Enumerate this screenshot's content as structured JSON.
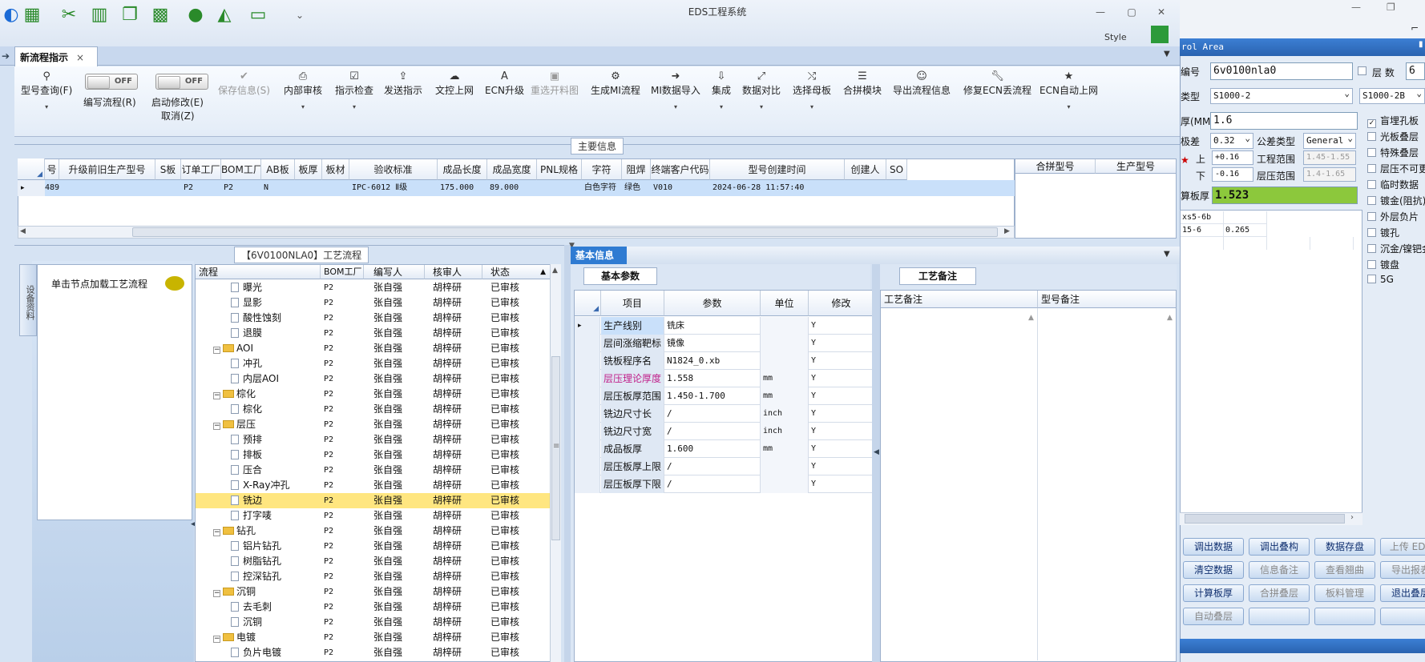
{
  "app": {
    "title": "EDS工程系统",
    "style_label": "Style"
  },
  "tabs": {
    "active": "新流程指示"
  },
  "toolbar": {
    "buttons": [
      {
        "label": "型号查询(F)",
        "icon": "search-icon"
      },
      {
        "label": "编写流程(R)",
        "icon": "toggle"
      },
      {
        "label": "启动修改(E)",
        "icon": "toggle"
      },
      {
        "label": "取消(Z)",
        "icon": ""
      },
      {
        "label": "保存信息(S)",
        "icon": "check-icon"
      },
      {
        "label": "内部审核",
        "icon": "print-icon"
      },
      {
        "label": "指示检查",
        "icon": "checkbox-icon"
      },
      {
        "label": "发送指示",
        "icon": "upload-icon"
      },
      {
        "label": "文控上网",
        "icon": "cloud-icon"
      },
      {
        "label": "ECN升级",
        "icon": "text-icon"
      },
      {
        "label": "重选开料图",
        "icon": "image-icon"
      },
      {
        "label": "生成MI流程",
        "icon": "gears-icon"
      },
      {
        "label": "MI数据导入",
        "icon": "import-icon"
      },
      {
        "label": "集成",
        "icon": "download-icon"
      },
      {
        "label": "数据对比",
        "icon": "compare-icon"
      },
      {
        "label": "选择母板",
        "icon": "shuffle-icon"
      },
      {
        "label": "合拼模块",
        "icon": "list-icon"
      },
      {
        "label": "导出流程信息",
        "icon": "smile-icon"
      },
      {
        "label": "修复ECN丢流程",
        "icon": "wrench-icon"
      },
      {
        "label": "ECN自动上网",
        "icon": "star-icon"
      }
    ],
    "toggle_off": "OFF"
  },
  "main_info": {
    "title": "主要信息",
    "columns": [
      "号",
      "升级前旧生产型号",
      "S板",
      "订单工厂",
      "BOM工厂",
      "AB板",
      "板厚",
      "板材",
      "验收标准",
      "成品长度",
      "成品宽度",
      "PNL规格",
      "字符",
      "阻焊",
      "终端客户代码",
      "型号创建时间",
      "创建人",
      "SO"
    ],
    "row": [
      "489",
      "",
      "",
      "P2",
      "P2",
      "N",
      "",
      "",
      "IPC-6012 Ⅱ级",
      "175.000",
      "89.000",
      "",
      "白色字符",
      "绿色",
      "V010",
      "2024-06-28 11:57:40",
      "",
      ""
    ],
    "merge_columns": [
      "合拼型号",
      "生产型号"
    ]
  },
  "process": {
    "title": "【6V0100NLA0】工艺流程",
    "side_tab": "设备资料",
    "node_hint": "单击节点加载工艺流程",
    "columns": [
      "流程",
      "BOM工厂",
      "编写人",
      "核审人",
      "状态"
    ],
    "rows": [
      {
        "name": "曝光",
        "level": 2,
        "type": "doc",
        "factory": "P2",
        "writer": "张自强",
        "reviewer": "胡梓研",
        "status": "已审核"
      },
      {
        "name": "显影",
        "level": 2,
        "type": "doc",
        "factory": "P2",
        "writer": "张自强",
        "reviewer": "胡梓研",
        "status": "已审核"
      },
      {
        "name": "酸性蚀刻",
        "level": 2,
        "type": "doc",
        "factory": "P2",
        "writer": "张自强",
        "reviewer": "胡梓研",
        "status": "已审核"
      },
      {
        "name": "退膜",
        "level": 2,
        "type": "doc",
        "factory": "P2",
        "writer": "张自强",
        "reviewer": "胡梓研",
        "status": "已审核"
      },
      {
        "name": "AOI",
        "level": 1,
        "type": "folder",
        "factory": "P2",
        "writer": "张自强",
        "reviewer": "胡梓研",
        "status": "已审核"
      },
      {
        "name": "冲孔",
        "level": 2,
        "type": "doc",
        "factory": "P2",
        "writer": "张自强",
        "reviewer": "胡梓研",
        "status": "已审核"
      },
      {
        "name": "内层AOI",
        "level": 2,
        "type": "doc",
        "factory": "P2",
        "writer": "张自强",
        "reviewer": "胡梓研",
        "status": "已审核"
      },
      {
        "name": "棕化",
        "level": 1,
        "type": "folder",
        "factory": "P2",
        "writer": "张自强",
        "reviewer": "胡梓研",
        "status": "已审核"
      },
      {
        "name": "棕化",
        "level": 2,
        "type": "doc",
        "factory": "P2",
        "writer": "张自强",
        "reviewer": "胡梓研",
        "status": "已审核"
      },
      {
        "name": "层压",
        "level": 1,
        "type": "folder",
        "factory": "P2",
        "writer": "张自强",
        "reviewer": "胡梓研",
        "status": "已审核"
      },
      {
        "name": "预排",
        "level": 2,
        "type": "doc",
        "factory": "P2",
        "writer": "张自强",
        "reviewer": "胡梓研",
        "status": "已审核"
      },
      {
        "name": "排板",
        "level": 2,
        "type": "doc",
        "factory": "P2",
        "writer": "张自强",
        "reviewer": "胡梓研",
        "status": "已审核"
      },
      {
        "name": "压合",
        "level": 2,
        "type": "doc",
        "factory": "P2",
        "writer": "张自强",
        "reviewer": "胡梓研",
        "status": "已审核"
      },
      {
        "name": "X-Ray冲孔",
        "level": 2,
        "type": "doc",
        "factory": "P2",
        "writer": "张自强",
        "reviewer": "胡梓研",
        "status": "已审核"
      },
      {
        "name": "铣边",
        "level": 2,
        "type": "doc",
        "factory": "P2",
        "writer": "张自强",
        "reviewer": "胡梓研",
        "status": "已审核",
        "selected": true
      },
      {
        "name": "打字唛",
        "level": 2,
        "type": "doc",
        "factory": "P2",
        "writer": "张自强",
        "reviewer": "胡梓研",
        "status": "已审核"
      },
      {
        "name": "钻孔",
        "level": 1,
        "type": "folder",
        "factory": "P2",
        "writer": "张自强",
        "reviewer": "胡梓研",
        "status": "已审核"
      },
      {
        "name": "铝片钻孔",
        "level": 2,
        "type": "doc",
        "factory": "P2",
        "writer": "张自强",
        "reviewer": "胡梓研",
        "status": "已审核"
      },
      {
        "name": "树脂钻孔",
        "level": 2,
        "type": "doc",
        "factory": "P2",
        "writer": "张自强",
        "reviewer": "胡梓研",
        "status": "已审核"
      },
      {
        "name": "控深钻孔",
        "level": 2,
        "type": "doc",
        "factory": "P2",
        "writer": "张自强",
        "reviewer": "胡梓研",
        "status": "已审核"
      },
      {
        "name": "沉铜",
        "level": 1,
        "type": "folder",
        "factory": "P2",
        "writer": "张自强",
        "reviewer": "胡梓研",
        "status": "已审核"
      },
      {
        "name": "去毛刺",
        "level": 2,
        "type": "doc",
        "factory": "P2",
        "writer": "张自强",
        "reviewer": "胡梓研",
        "status": "已审核"
      },
      {
        "name": "沉铜",
        "level": 2,
        "type": "doc",
        "factory": "P2",
        "writer": "张自强",
        "reviewer": "胡梓研",
        "status": "已审核"
      },
      {
        "name": "电镀",
        "level": 1,
        "type": "folder",
        "factory": "P2",
        "writer": "张自强",
        "reviewer": "胡梓研",
        "status": "已审核"
      },
      {
        "name": "负片电镀",
        "level": 2,
        "type": "doc",
        "factory": "P2",
        "writer": "张自强",
        "reviewer": "胡梓研",
        "status": "已审核"
      }
    ]
  },
  "basic_info": {
    "title": "基本信息",
    "params_tab": "基本参数",
    "columns": [
      "项目",
      "参数",
      "单位",
      "修改"
    ],
    "rows": [
      {
        "item": "生产线别",
        "value": "铣床",
        "unit": "",
        "edit": "Y",
        "current": true
      },
      {
        "item": "层间涨缩靶标",
        "value": "镜像",
        "unit": "",
        "edit": "Y"
      },
      {
        "item": "铣板程序名",
        "value": "N1824_0.xb",
        "unit": "",
        "edit": "Y"
      },
      {
        "item": "层压理论厚度",
        "value": "1.558",
        "unit": "mm",
        "edit": "Y",
        "highlight": true
      },
      {
        "item": "层压板厚范围",
        "value": "1.450-1.700",
        "unit": "mm",
        "edit": "Y"
      },
      {
        "item": "铣边尺寸长",
        "value": "/",
        "unit": "inch",
        "edit": "Y"
      },
      {
        "item": "铣边尺寸宽",
        "value": "/",
        "unit": "inch",
        "edit": "Y"
      },
      {
        "item": "成品板厚",
        "value": "1.600",
        "unit": "mm",
        "edit": "Y"
      },
      {
        "item": "层压板厚上限",
        "value": "/",
        "unit": "",
        "edit": "Y"
      },
      {
        "item": "层压板厚下限",
        "value": "/",
        "unit": "",
        "edit": "Y"
      }
    ],
    "remarks_tab": "工艺备注",
    "remark_columns": [
      "工艺备注",
      "型号备注"
    ]
  },
  "right": {
    "bar_title": "rol Area",
    "part_label": "编号",
    "part_value": "6v0100nla0",
    "layers_label": "层 数",
    "layers_value": "6",
    "type_label": "类型",
    "type_value": "S1000-2",
    "type_value2": "S1000-2B",
    "thick_label": "厚(MM)",
    "thick_value": "1.6",
    "tol_label": "极差",
    "tol_value": "0.32",
    "tol_type_label": "公差类型",
    "tol_type_value": "General",
    "upper_label": "上",
    "upper_value": "+0.16",
    "lower_label": "下",
    "lower_value": "-0.16",
    "eng_range_label": "工程范围",
    "eng_range_value": "1.45-1.55",
    "lam_range_label": "层压范围",
    "lam_range_value": "1.4-1.65",
    "calc_label": "算板厚",
    "calc_value": "1.523",
    "stack_rows": [
      [
        "xs5-6b",
        ""
      ],
      [
        "15-6",
        "0.265"
      ]
    ],
    "checkboxes": [
      {
        "label": "盲埋孔板",
        "checked": true
      },
      {
        "label": "光板叠层",
        "checked": false
      },
      {
        "label": "特殊叠层",
        "checked": false
      },
      {
        "label": "层压不可更",
        "checked": false
      },
      {
        "label": "临时数据",
        "checked": false
      },
      {
        "label": "镀金(阻抗)",
        "checked": false
      },
      {
        "label": "外层负片",
        "checked": false
      },
      {
        "label": "镀孔",
        "checked": false
      },
      {
        "label": "沉金/镍钯金",
        "checked": false
      },
      {
        "label": "镀盘",
        "checked": false
      },
      {
        "label": "5G",
        "checked": false
      }
    ],
    "buttons": [
      [
        "调出数据",
        "调出叠构",
        "数据存盘",
        "上传 EDS"
      ],
      [
        "清空数据",
        "信息备注",
        "查看翘曲",
        "导出报表"
      ],
      [
        "计算板厚",
        "合拼叠层",
        "板料管理",
        "退出叠层"
      ],
      [
        "自动叠层",
        "",
        "",
        ""
      ]
    ]
  }
}
